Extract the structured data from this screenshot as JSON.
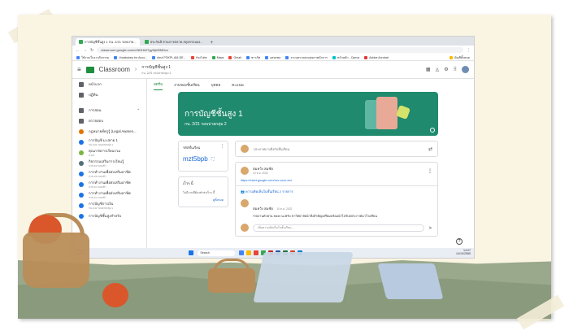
{
  "browser": {
    "tabs": [
      {
        "label": "การบัญชีชั้นสูง 1 กน. 2/21 รอบบ่าย..."
      },
      {
        "label": "ประกันสิ ส่วนการตลาด สถุยกรรมอง..."
      }
    ],
    "url": "classroom.google.com/c/NDI4MTgyNjM0MDcx",
    "bookmarks": [
      "ใช้งาน/ใบงานกิจกรรม",
      "Vocabulary for Acco...",
      "Aeul POKPL AM-DE...",
      "YouTube",
      "Maps",
      "Gmail",
      "ชาวภัท",
      "อสยกพล",
      "ระบบตรวจสอบสุขภาพนักการ",
      "หน้าหลัก - Canva",
      "Adobe Acrobat",
      "บัญชีทั้งหมด"
    ]
  },
  "app": {
    "title": "Classroom",
    "breadcrumb_title": "การบัญชีชั้นสูง 1",
    "breadcrumb_sub": "กน. 2/21 รอบบ่ายกลุ่ม 2"
  },
  "class_tabs": [
    "สตรีม",
    "งานของชั้นเรียน",
    "บุคคล",
    "คะแนน"
  ],
  "sidebar": {
    "items": [
      {
        "label": "หน้าแรก",
        "sub": ""
      },
      {
        "label": "ปฏิทิน",
        "sub": ""
      },
      {
        "label": "การสอน",
        "sub": ""
      },
      {
        "label": "ตรวจสอบ",
        "sub": ""
      },
      {
        "label": "กฎหมายที่ครูรู้ (Legal Awaren...",
        "sub": ""
      },
      {
        "label": "การบัญชี ม.ปลาย 1",
        "sub": "กน.1/21 รอบบ่ายกลุ่ม 1"
      },
      {
        "label": "คุณภาพการเรียนรวม",
        "sub": "ห.3/4"
      },
      {
        "label": "กิจกรรมเสริมการเรียนรู้",
        "sub": "ปวช.2/3 รอบเช้า"
      },
      {
        "label": "การทำงานเพื่อส่งเสริมอาชีพ",
        "sub": "ปวช.1/6 รอบเช้า"
      },
      {
        "label": "การทำงานเพื่อส่งเสริมอาชีพ",
        "sub": "ปวช.1/4 รอบเช้า"
      },
      {
        "label": "การทำงานเพื่อส่งเสริมอาชีพ",
        "sub": "ปวช.1/2 รอบเช้า"
      },
      {
        "label": "การบัญชีการเงิน",
        "sub": "กน.1/11 รอบบ่ายกลุ่ม 1"
      },
      {
        "label": "การบัญชีชั้นสูงสำหรับ",
        "sub": ""
      }
    ]
  },
  "banner": {
    "title": "การบัญชีชั้นสูง 1",
    "subtitle": "กน. 2/21 รอบบ่ายกลุ่ม 2"
  },
  "class_code": {
    "label": "รหัสชั้นเรียน",
    "code": "mzt5bpb"
  },
  "upcoming": {
    "label": "เร็วๆ นี้",
    "text": "ไม่มีงานที่ต้องทำส่งเร็วๆ นี้",
    "link": "ดูทั้งหมด"
  },
  "announce_placeholder": "ประกาศบางสิ่งกับชั้นเรียน",
  "post": {
    "author": "สมหวัง สมชัย",
    "date": "10 ต.ค. 2022",
    "link": "https://meet.google.com/xxx-xxxx-xxx",
    "comments_label": "ความคิดเห็นในชั้นเรียน 2 รายการ",
    "comment_author": "สมหวัง สมชัย",
    "comment_date": "10 ต.ค. 2022",
    "comment_text": "รายงานตัวผ่าน Meet นะครับ ขาวิทยาลัยนำสิ่งสำคัญเตรียมพร้อมนำไปรับยประกาศนาโรงเรียน",
    "reply_placeholder": "เพิ่มความคิดเห็นในชั้นเรียน..."
  },
  "taskbar": {
    "weather_temp": "CPALL-8",
    "weather_sub": "-1.26%",
    "search": "Search",
    "time": "14:07",
    "date": "14/10/2565"
  },
  "colors": {
    "brand_green": "#1e8e3e",
    "banner": "#1f8a6e",
    "link": "#1967d2"
  }
}
